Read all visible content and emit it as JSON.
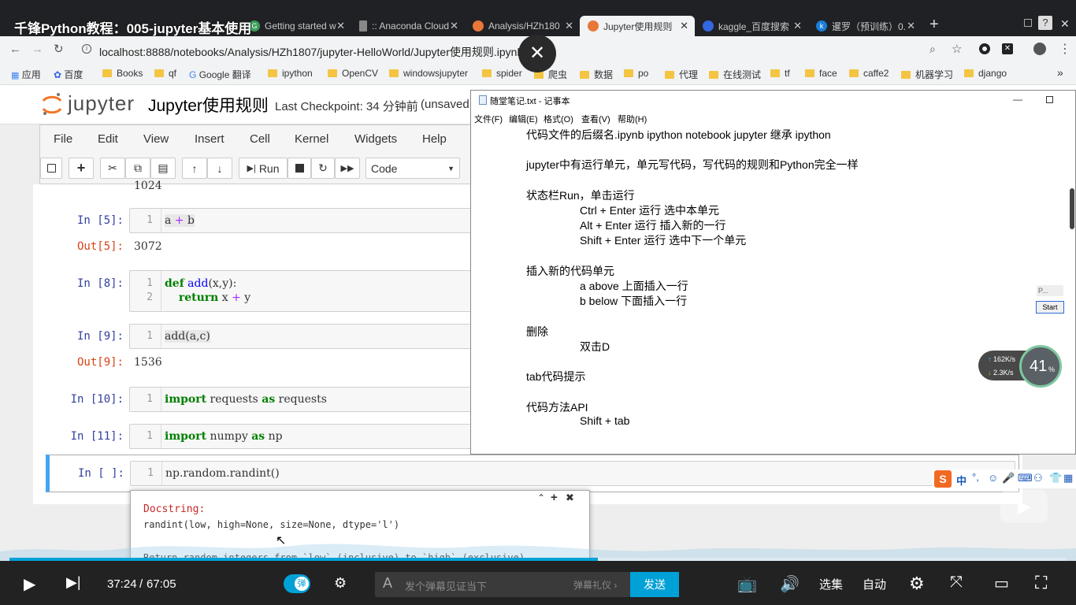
{
  "video": {
    "title": "千锋Python教程：005-jupyter基本使用",
    "time_current": "37:24",
    "time_sep": "/",
    "time_total": "67:05",
    "danmaku_toggle": "弹",
    "danmaku_placeholder": "发个弹幕见证当下",
    "danmaku_etiquette": "弹幕礼仪 ›",
    "send": "发送",
    "episodes": "选集",
    "auto": "自动",
    "progress": 0.557
  },
  "browser": {
    "tabs": [
      {
        "label": "Getting started w",
        "fav": "G",
        "color": "#3c9c5a"
      },
      {
        "label": ":: Anaconda Cloud",
        "fav": "",
        "color": "#888"
      },
      {
        "label": "Analysis/HZh180",
        "fav": "",
        "color": "#e8773a"
      },
      {
        "label": "Jupyter使用规则",
        "fav": "",
        "color": "#e8773a"
      },
      {
        "label": "kaggle_百度搜索",
        "fav": "",
        "color": "#3466e0"
      },
      {
        "label": "暹罗（预训练）0.",
        "fav": "k",
        "color": "#1a7ed8"
      }
    ],
    "url": "localhost:8888/notebooks/Analysis/HZh1807/jupyter-HelloWorld/Jupyter使用规则.ipynb",
    "bookmarks": [
      "应用",
      "百度",
      "Books",
      "qf",
      "Google 翻译",
      "ipython",
      "OpenCV",
      "windowsjupyter",
      "spider",
      "爬虫",
      "数据",
      "po",
      "代理",
      "在线测试",
      "tf",
      "face",
      "caffe2",
      "机器学习",
      "django"
    ],
    "more": "»"
  },
  "jupyter": {
    "logo": "jupyter",
    "notebook_name": "Jupyter使用规则",
    "checkpoint": "Last Checkpoint: 34 分钟前",
    "unsaved": "(unsaved",
    "menus": [
      "File",
      "Edit",
      "View",
      "Insert",
      "Cell",
      "Kernel",
      "Widgets",
      "Help"
    ],
    "run_label": "Run",
    "cell_type": "Code",
    "partial_output": "1024",
    "cells": [
      {
        "prompt": "In  [5]:",
        "lines": [
          "a + b"
        ],
        "out_prompt": "Out[5]:",
        "out": "3072"
      },
      {
        "prompt": "In  [8]:",
        "lines": [
          "def add(x,y):",
          "    return x + y"
        ]
      },
      {
        "prompt": "In  [9]:",
        "lines": [
          "add(a,c)"
        ],
        "out_prompt": "Out[9]:",
        "out": "1536"
      },
      {
        "prompt": "In  [10]:",
        "lines": [
          "import requests as requests"
        ]
      },
      {
        "prompt": "In  [11]:",
        "lines": [
          "import numpy as np"
        ]
      },
      {
        "prompt": "In  [ ]:",
        "lines": [
          "np.random.randint()"
        ]
      }
    ],
    "tooltip": {
      "heading": "Docstring:",
      "signature": "randint(low, high=None, size=None, dtype='l')",
      "desc": "Return random integers from `low` (inclusive) to `high` (exclusive)."
    }
  },
  "notepad": {
    "title": "随堂笔记.txt - 记事本",
    "menus": [
      "文件(F)",
      "编辑(E)",
      "格式(O)",
      "查看(V)",
      "帮助(H)"
    ],
    "lines": [
      {
        "t": "代码文件的后缀名.ipynb  ipython notebook   jupyter 继承 ipython",
        "i": 0
      },
      {
        "t": "",
        "i": 0
      },
      {
        "t": "jupyter中有运行单元，单元写代码，写代码的规则和Python完全一样",
        "i": 0
      },
      {
        "t": "",
        "i": 0
      },
      {
        "t": "状态栏Run，单击运行",
        "i": 0
      },
      {
        "t": "Ctrl + Enter 运行 选中本单元",
        "i": 1
      },
      {
        "t": "Alt + Enter 运行 插入新的一行",
        "i": 1
      },
      {
        "t": "Shift + Enter 运行 选中下一个单元",
        "i": 1
      },
      {
        "t": "",
        "i": 0
      },
      {
        "t": "插入新的代码单元",
        "i": 0
      },
      {
        "t": "a above 上面插入一行",
        "i": 1
      },
      {
        "t": "b below   下面插入一行",
        "i": 1
      },
      {
        "t": "",
        "i": 0
      },
      {
        "t": "删除",
        "i": 0
      },
      {
        "t": "双击D",
        "i": 1
      },
      {
        "t": "",
        "i": 0
      },
      {
        "t": "tab代码提示",
        "i": 0
      },
      {
        "t": "",
        "i": 0
      },
      {
        "t": "代码方法API",
        "i": 0
      },
      {
        "t": "Shift + tab",
        "i": 1
      }
    ]
  },
  "overlay": {
    "speed_up": "162K/s",
    "speed_down": "2.3K/s",
    "percent": "41",
    "percent_unit": "%",
    "start_btn": "Start",
    "p_label": "P...",
    "ime": "中"
  }
}
